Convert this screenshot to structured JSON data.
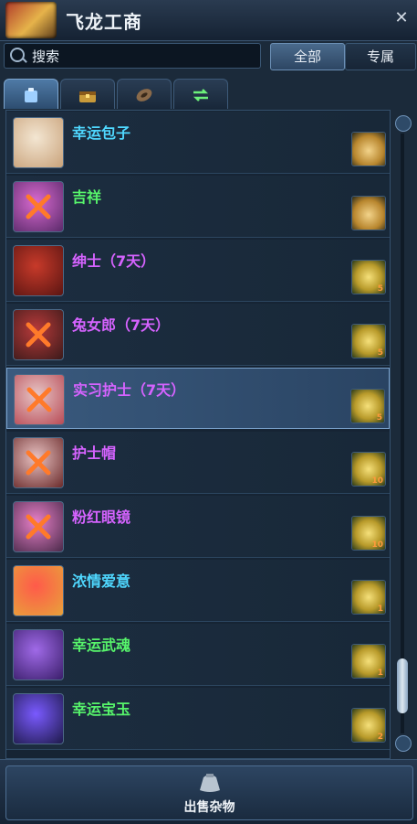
{
  "window": {
    "title": "飞龙工商",
    "close_icon": "close-icon"
  },
  "search": {
    "placeholder": "搜索",
    "value": ""
  },
  "filters": {
    "all": "全部",
    "exclusive": "专属"
  },
  "tabs": [
    {
      "icon": "backpack-icon",
      "active": true
    },
    {
      "icon": "chest-icon",
      "active": false
    },
    {
      "icon": "material-icon",
      "active": false
    },
    {
      "icon": "exchange-icon",
      "active": false
    }
  ],
  "items": [
    {
      "name": "幸运包子",
      "color": "#4fd8ff",
      "thumb": [
        "#f3e6d2",
        "#c9a27a"
      ],
      "crossed": false,
      "price_icon": "fortune-cookie-icon",
      "count": ""
    },
    {
      "name": "吉祥",
      "color": "#57f56b",
      "thumb": [
        "#d96ad0",
        "#5a2a6a"
      ],
      "crossed": true,
      "price_icon": "fortune-cookie-icon",
      "count": ""
    },
    {
      "name": "绅士（7天）",
      "color": "#d663ff",
      "thumb": [
        "#c83a2a",
        "#5a1512"
      ],
      "crossed": false,
      "price_icon": "gold-leaf-icon",
      "count": "5"
    },
    {
      "name": "兔女郎（7天）",
      "color": "#d663ff",
      "thumb": [
        "#b83a3a",
        "#3a1a1a"
      ],
      "crossed": true,
      "price_icon": "gold-leaf-icon",
      "count": "5"
    },
    {
      "name": "实习护士（7天）",
      "color": "#d663ff",
      "thumb": [
        "#e7c6c6",
        "#b84a55"
      ],
      "crossed": true,
      "price_icon": "gold-leaf-icon",
      "count": "5"
    },
    {
      "name": "护士帽",
      "color": "#d663ff",
      "thumb": [
        "#e8c2c2",
        "#6a2a2a"
      ],
      "crossed": true,
      "price_icon": "gold-leaf-icon",
      "count": "10"
    },
    {
      "name": "粉红眼镜",
      "color": "#d663ff",
      "thumb": [
        "#e880c8",
        "#4a2a4a"
      ],
      "crossed": true,
      "price_icon": "gold-leaf-icon",
      "count": "10"
    },
    {
      "name": "浓情爱意",
      "color": "#4fd8ff",
      "thumb": [
        "#ff5a4a",
        "#e8a23a"
      ],
      "crossed": false,
      "price_icon": "gold-leaf-icon",
      "count": "1"
    },
    {
      "name": "幸运武魂",
      "color": "#57f56b",
      "thumb": [
        "#a06ae8",
        "#3a1e6a"
      ],
      "crossed": false,
      "price_icon": "gold-leaf-icon",
      "count": "1"
    },
    {
      "name": "幸运宝玉",
      "color": "#57f56b",
      "thumb": [
        "#7a5aff",
        "#1e1a4a"
      ],
      "crossed": false,
      "price_icon": "gold-leaf-icon",
      "count": "2"
    }
  ],
  "selected_index": 4,
  "sell_button": {
    "label": "出售杂物",
    "icon": "sack-icon"
  }
}
